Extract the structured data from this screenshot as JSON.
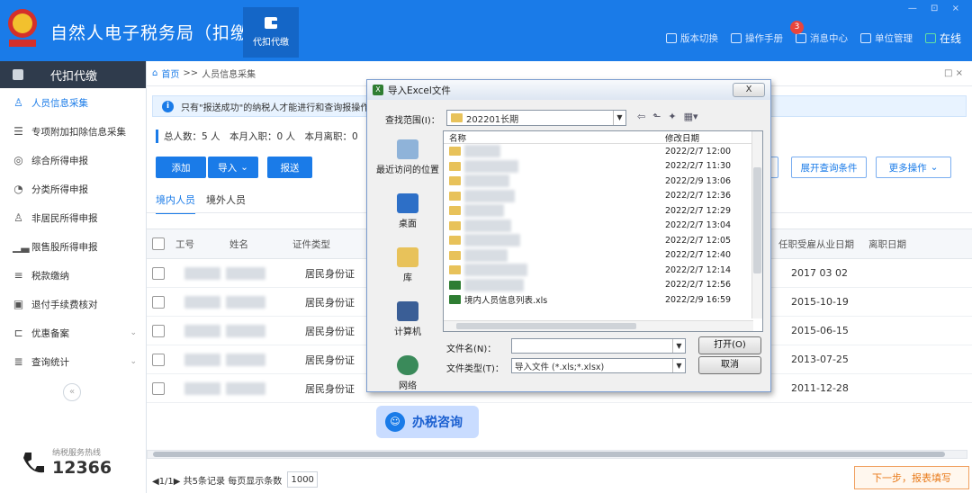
{
  "app": {
    "title": "自然人电子税务局（扣缴端）",
    "top_tab": "代扣代缴",
    "links": [
      "版本切换",
      "操作手册",
      "消息中心",
      "单位管理"
    ],
    "message_badge": "3",
    "online": "在线",
    "window_controls": "— ⊡ ×"
  },
  "sidebar": {
    "header": "代扣代缴",
    "items": [
      {
        "label": "人员信息采集",
        "icon": "person-icon"
      },
      {
        "label": "专项附加扣除信息采集",
        "icon": "list-icon"
      },
      {
        "label": "综合所得申报",
        "icon": "stack-icon"
      },
      {
        "label": "分类所得申报",
        "icon": "circle-icon"
      },
      {
        "label": "非居民所得申报",
        "icon": "person-outline-icon"
      },
      {
        "label": "限售股所得申报",
        "icon": "bar-icon"
      },
      {
        "label": "税款缴纳",
        "icon": "pay-icon"
      },
      {
        "label": "退付手续费核对",
        "icon": "doc-icon"
      },
      {
        "label": "优惠备案",
        "icon": "bracket-icon"
      },
      {
        "label": "查询统计",
        "icon": "query-icon"
      }
    ],
    "collapse": "«",
    "hotline_label": "纳税服务热线",
    "hotline_number": "12366"
  },
  "main": {
    "breadcrumb_home": "首页",
    "breadcrumb_sep": ">>",
    "breadcrumb_page": "人员信息采集",
    "close": "□ ×",
    "notice": "只有\"报送成功\"的纳税人才能进行和查询报操作，",
    "stats": "总人数：5 人　本月入职：0 人　本月离职：0",
    "buttons": {
      "add": "添加",
      "import": "导入",
      "report": "报送",
      "expand": "展开查询条件",
      "more": "更多操作"
    },
    "tabs": [
      "境内人员",
      "境外人员"
    ],
    "columns": [
      "工号",
      "姓名",
      "证件类型",
      "任职受雇从业日期",
      "离职日期"
    ],
    "rows": [
      {
        "id_type": "居民身份证",
        "date": "2017 03 02"
      },
      {
        "id_type": "居民身份证",
        "date": "2015-10-19"
      },
      {
        "id_type": "居民身份证",
        "date": "2015-06-15"
      },
      {
        "id_type": "居民身份证",
        "date": "2013-07-25"
      },
      {
        "id_type": "居民身份证",
        "date": "2011-12-28"
      }
    ],
    "pager_text": "◀1/1▶ 共5条记录 每页显示条数",
    "page_size": "1000",
    "next": "下一步，报表填写",
    "consult": "办税咨询"
  },
  "dialog": {
    "title": "导入Excel文件",
    "close": "X",
    "lookin_label": "查找范围(I)：",
    "lookin_value": "202201长期",
    "places": [
      "最近访问的位置",
      "桌面",
      "库",
      "计算机",
      "网络"
    ],
    "col_name": "名称",
    "col_date": "修改日期",
    "files": [
      {
        "date": "2022/2/7 12:00"
      },
      {
        "date": "2022/2/7 11:30"
      },
      {
        "date": "2022/2/9 13:06"
      },
      {
        "date": "2022/2/7 12:36"
      },
      {
        "date": "2022/2/7 12:29"
      },
      {
        "date": "2022/2/7 13:04"
      },
      {
        "date": "2022/2/7 12:05"
      },
      {
        "date": "2022/2/7 12:40"
      },
      {
        "date": "2022/2/7 12:14"
      },
      {
        "date": "2022/2/7 12:56"
      },
      {
        "name": "境内人员信息列表.xls",
        "date": "2022/2/9 16:59"
      }
    ],
    "filename_label": "文件名(N)：",
    "filetype_label": "文件类型(T)：",
    "filetype_value": "导入文件 (*.xls;*.xlsx)",
    "open": "打开(O)",
    "cancel": "取消"
  }
}
